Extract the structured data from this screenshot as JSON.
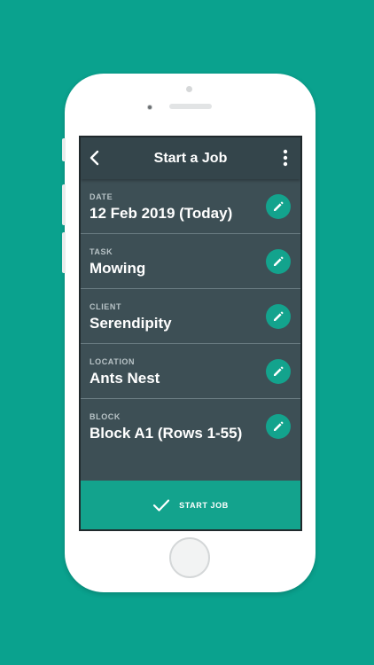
{
  "app_bar": {
    "title": "Start a Job",
    "back_icon": "chevron-left-icon",
    "menu_icon": "more-vertical-icon"
  },
  "fields": [
    {
      "label": "DATE",
      "value": "12 Feb 2019 (Today)"
    },
    {
      "label": "TASK",
      "value": "Mowing"
    },
    {
      "label": "CLIENT",
      "value": "Serendipity"
    },
    {
      "label": "LOCATION",
      "value": "Ants Nest"
    },
    {
      "label": "BLOCK",
      "value": "Block A1 (Rows 1-55)"
    }
  ],
  "edit_icon": "pencil-icon",
  "start_button": {
    "label": "START JOB",
    "icon": "check-icon"
  },
  "colors": {
    "background": "#0aa28e",
    "screen": "#3d4f55",
    "app_bar": "#34454b",
    "accent": "#13a38d"
  }
}
